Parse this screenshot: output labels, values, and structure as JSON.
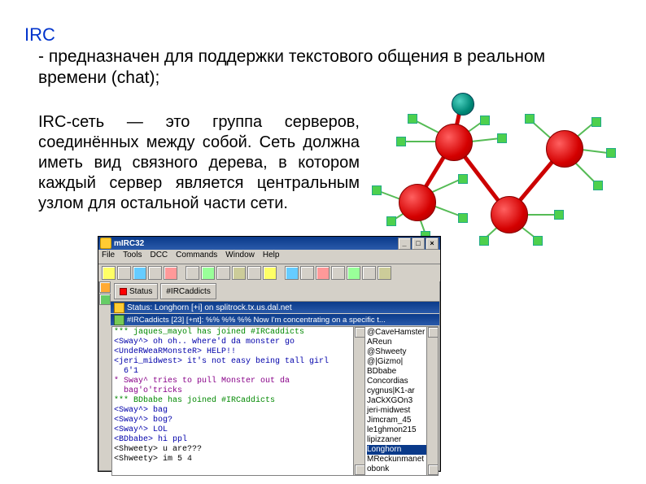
{
  "heading": "IRC",
  "desc1": "- предназначен для поддержки текстового общения в реальном времени (chat);",
  "desc2": "IRC-сеть — это группа серверов, соединённых между собой. Сеть должна иметь вид связного дерева, в котором каждый сервер является центральным узлом для остальной части сети.",
  "mirc": {
    "title": "mIRC32",
    "menu": [
      "File",
      "Tools",
      "DCC",
      "Commands",
      "Window",
      "Help"
    ],
    "tabs": [
      "Status",
      "#IRCaddicts"
    ],
    "statusline": "Status: Longhorn [+i] on splitrock.tx.us.dal.net",
    "chanheader": "#IRCaddicts [23] [+nt]: %% %% %% Now I'm concentrating on a specific t...",
    "log": [
      {
        "c": "g",
        "t": "*** jaques_mayol has joined #IRCaddicts"
      },
      {
        "c": "b",
        "t": "<Sway^> oh oh.. where'd da monster go"
      },
      {
        "c": "b",
        "t": "<UndeRWeaRMonsteR> HELP!!"
      },
      {
        "c": "b",
        "t": "<jeri_midwest> it's not easy being tall girl"
      },
      {
        "c": "b",
        "t": "  6'1"
      },
      {
        "c": "m",
        "t": "* Sway^ tries to pull Monster out da"
      },
      {
        "c": "m",
        "t": "  bag'o'tricks"
      },
      {
        "c": "g",
        "t": "*** BDbabe has joined #IRCaddicts"
      },
      {
        "c": "b",
        "t": "<Sway^> bag"
      },
      {
        "c": "b",
        "t": "<Sway^> bog?"
      },
      {
        "c": "b",
        "t": "<Sway^> LOL"
      },
      {
        "c": "b",
        "t": "<BDbabe> hi ppl"
      },
      {
        "c": "k",
        "t": "<Shweety> u are???"
      },
      {
        "c": "k",
        "t": "<Shweety> im 5 4"
      }
    ],
    "nicks": [
      "@CaveHamster",
      "AReun",
      "@Shweety",
      "@|Gizmo|",
      "BDbabe",
      "Concordias",
      "cygnus|K1-ar",
      "JaCkXGOn3",
      "jeri-midwest",
      "Jimcram_45",
      "le1ghmon215",
      "lipizzaner",
      "Longhorn",
      "MReckunmanet",
      "obonk"
    ],
    "nicksel": 12
  }
}
